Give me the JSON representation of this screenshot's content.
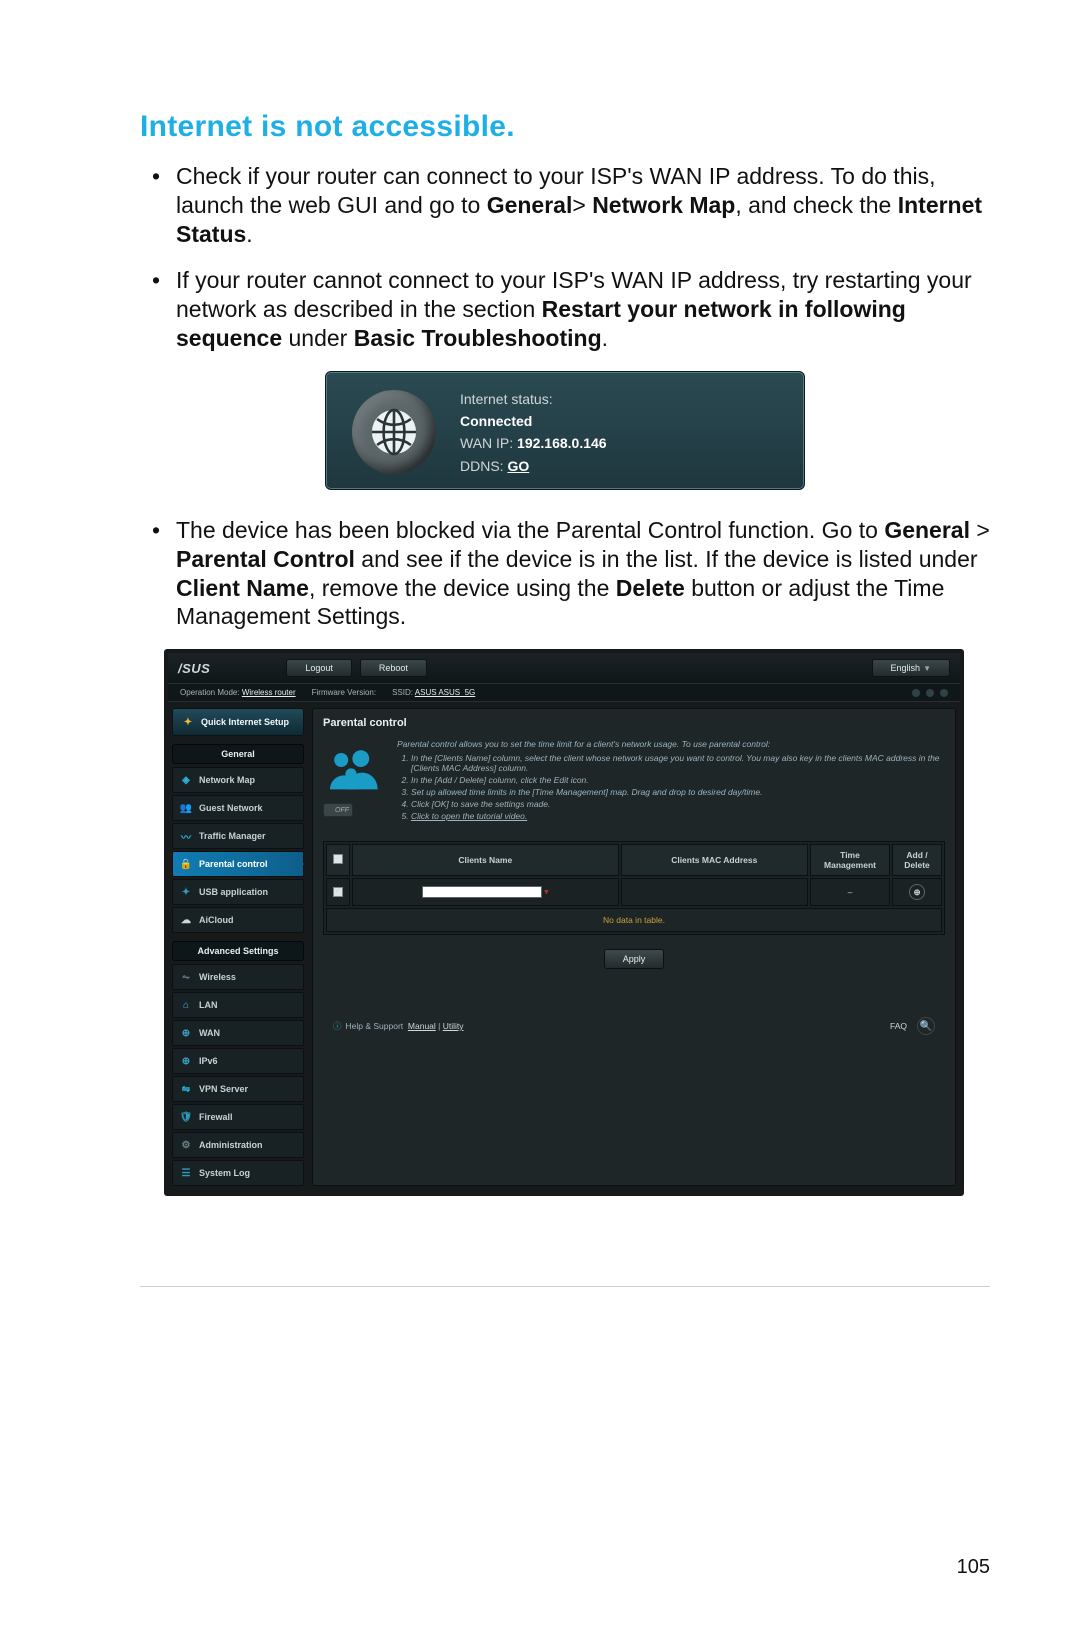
{
  "page_number": "105",
  "heading": "Internet is not accessible.",
  "bullets": {
    "b1_pre": "Check if your router can connect to your ISP's WAN IP address. To do this, launch the web GUI and go to ",
    "b1_bold1": "General",
    "b1_gt": "> ",
    "b1_bold2": "Network Map",
    "b1_mid": ", and check the ",
    "b1_bold3": "Internet Status",
    "b1_end": ".",
    "b2_pre": "If your router cannot connect to your ISP's WAN IP address, try restarting your network as described in the section ",
    "b2_bold1": "Restart your network in following sequence",
    "b2_mid": " under ",
    "b2_bold2": "Basic Troubleshooting",
    "b2_end": ".",
    "b3_pre": "The device has been blocked via the Parental Control function. Go to ",
    "b3_bold1": "General",
    "b3_gt": " > ",
    "b3_bold2": "Parental Control",
    "b3_mid": " and see if the device is in the list. If the device is listed under ",
    "b3_bold3": "Client Name",
    "b3_mid2": ", remove the device using the ",
    "b3_bold4": "Delete",
    "b3_end": " button or adjust the Time Management Settings."
  },
  "status_card": {
    "status_label": "Internet status:",
    "status_value": "Connected",
    "wanip_label": "WAN IP: ",
    "wanip_value": "192.168.0.146",
    "ddns_label": "DDNS: ",
    "ddns_value": "GO"
  },
  "router": {
    "brand": "/SUS",
    "logout": "Logout",
    "reboot": "Reboot",
    "language": "English",
    "info": {
      "op_mode_label": "Operation Mode:",
      "op_mode_value": "Wireless router",
      "fw_label": "Firmware Version:",
      "ssid_label": "SSID:",
      "ssid_value": "ASUS  ASUS_5G"
    },
    "quick_setup": "Quick Internet Setup",
    "cap_general": "General",
    "cap_advanced": "Advanced Settings",
    "nav_general": [
      {
        "label": "Network Map",
        "icon": "◈",
        "cls": "c-cyan"
      },
      {
        "label": "Guest Network",
        "icon": "👥",
        "cls": "c-cyan"
      },
      {
        "label": "Traffic Manager",
        "icon": "〰",
        "cls": "c-cyan"
      },
      {
        "label": "Parental control",
        "icon": "🔒",
        "cls": "c-lock",
        "active": true
      },
      {
        "label": "USB application",
        "icon": "✦",
        "cls": "c-usb"
      },
      {
        "label": "AiCloud",
        "icon": "☁",
        "cls": "c-cloud"
      }
    ],
    "nav_advanced": [
      {
        "label": "Wireless",
        "icon": "⏦",
        "cls": "c-wifi"
      },
      {
        "label": "LAN",
        "icon": "⌂",
        "cls": "c-home"
      },
      {
        "label": "WAN",
        "icon": "⊕",
        "cls": "c-globe"
      },
      {
        "label": "IPv6",
        "icon": "⊕",
        "cls": "c-globe"
      },
      {
        "label": "VPN Server",
        "icon": "⇋",
        "cls": "c-cyan"
      },
      {
        "label": "Firewall",
        "icon": "🛡",
        "cls": "c-shield"
      },
      {
        "label": "Administration",
        "icon": "⚙",
        "cls": "c-gear"
      },
      {
        "label": "System Log",
        "icon": "☰",
        "cls": "c-log"
      }
    ],
    "main": {
      "title": "Parental control",
      "intro": "Parental control allows you to set the time limit for a client's network usage. To use parental control:",
      "steps": [
        "In the [Clients Name] column, select the client whose network usage you want to control. You may also key in the clients MAC address in the [Clients MAC Address] column.",
        "In the [Add / Delete] column, click the Edit icon.",
        "Set up allowed time limits in the [Time Management] map. Drag and drop to desired day/time.",
        "Click [OK] to save the settings made."
      ],
      "step_link": "Click to open the tutorial video.",
      "toggle": "OFF",
      "table": {
        "h_name": "Clients Name",
        "h_mac": "Clients MAC Address",
        "h_time": "Time Management",
        "h_add": "Add / Delete",
        "nodata": "No data in table."
      },
      "apply": "Apply",
      "footer": {
        "help_label": "Help & Support",
        "manual": "Manual",
        "utility": "Utility",
        "faq": "FAQ"
      }
    }
  }
}
